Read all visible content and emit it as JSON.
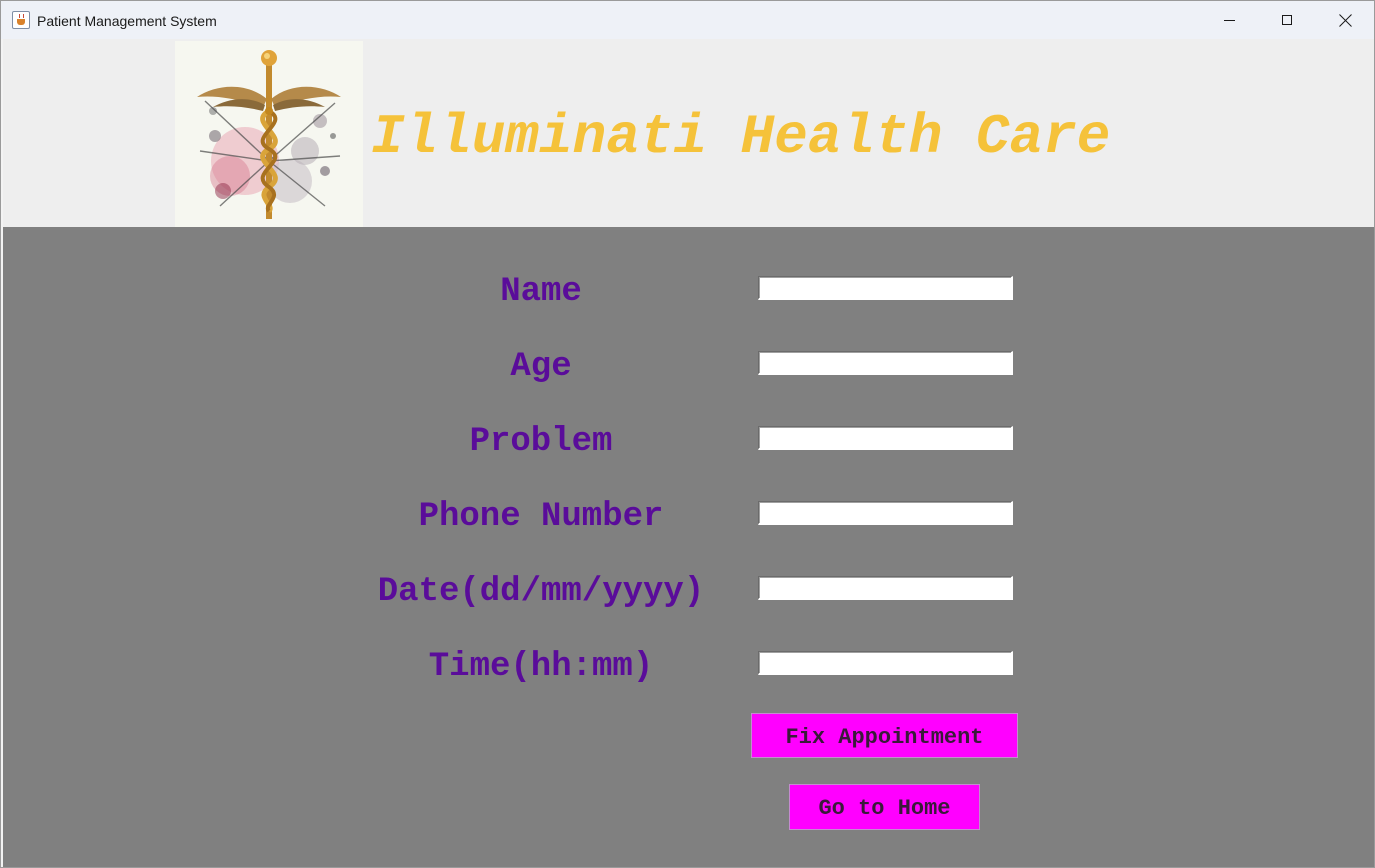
{
  "window": {
    "title": "Patient Management System",
    "icon": "java-cup-icon",
    "controls": [
      "minimize-icon",
      "maximize-icon",
      "close-icon"
    ]
  },
  "header": {
    "hospital_name": "Illuminati Health Care",
    "logo": "caduceus-logo",
    "name_color": "#f5c23a",
    "background": "#eeeeee"
  },
  "form": {
    "background": "#808080",
    "label_color": "#5a0c9a",
    "fields": [
      {
        "label": "Name",
        "value": ""
      },
      {
        "label": "Age",
        "value": ""
      },
      {
        "label": "Problem",
        "value": ""
      },
      {
        "label": "Phone Number",
        "value": ""
      },
      {
        "label": "Date(dd/mm/yyyy)",
        "value": ""
      },
      {
        "label": "Time(hh:mm)",
        "value": ""
      }
    ],
    "buttons": {
      "fix_appointment": "Fix Appointment",
      "go_home": "Go to Home",
      "color": "#ff00ff"
    }
  }
}
